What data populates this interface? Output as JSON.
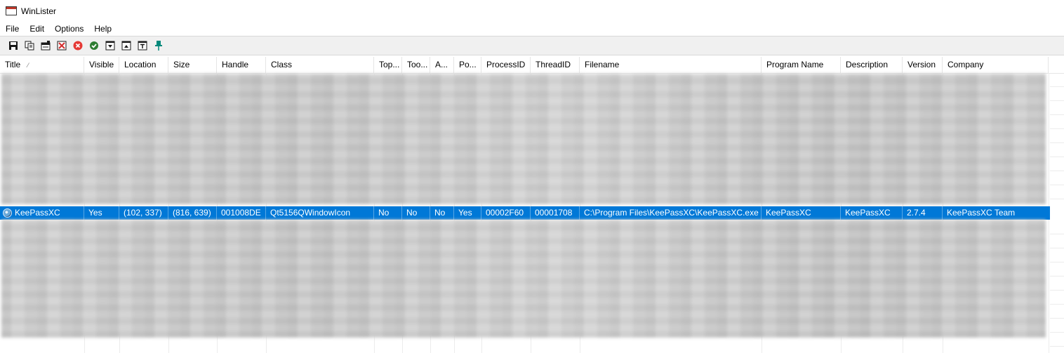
{
  "window": {
    "title": "WinLister"
  },
  "menu": [
    "File",
    "Edit",
    "Options",
    "Help"
  ],
  "toolbar": {
    "buttons": [
      {
        "name": "save-icon",
        "color": "#1a1a1a"
      },
      {
        "name": "copy-icon",
        "color": "#1a1a1a"
      },
      {
        "name": "properties-icon",
        "color": "#1a1a1a"
      },
      {
        "name": "close-window-icon",
        "color": "#d32f2f"
      },
      {
        "name": "terminate-icon",
        "color": "#e53935"
      },
      {
        "name": "check-icon",
        "color": "#2e7d32"
      },
      {
        "name": "minimize-icon",
        "color": "#1a1a1a"
      },
      {
        "name": "maximize-icon",
        "color": "#1a1a1a"
      },
      {
        "name": "always-on-top-icon",
        "color": "#1a1a1a"
      },
      {
        "name": "pin-icon",
        "color": "#00897b"
      }
    ]
  },
  "table": {
    "columns": [
      "Title",
      "Visible",
      "Location",
      "Size",
      "Handle",
      "Class",
      "Top...",
      "Too...",
      "A...",
      "Po...",
      "ProcessID",
      "ThreadID",
      "Filename",
      "Program Name",
      "Description",
      "Version",
      "Company"
    ],
    "sort_indicator": "⁄",
    "selected_row": [
      "KeePassXC",
      "Yes",
      "(102, 337)",
      "(816, 639)",
      "001008DE",
      "Qt5156QWindowIcon",
      "No",
      "No",
      "No",
      "Yes",
      "00002F60",
      "00001708",
      "C:\\Program Files\\KeePassXC\\KeePassXC.exe",
      "KeePassXC",
      "KeePassXC",
      "2.7.4",
      "KeePassXC Team"
    ],
    "selection_color": "#0078d7"
  }
}
